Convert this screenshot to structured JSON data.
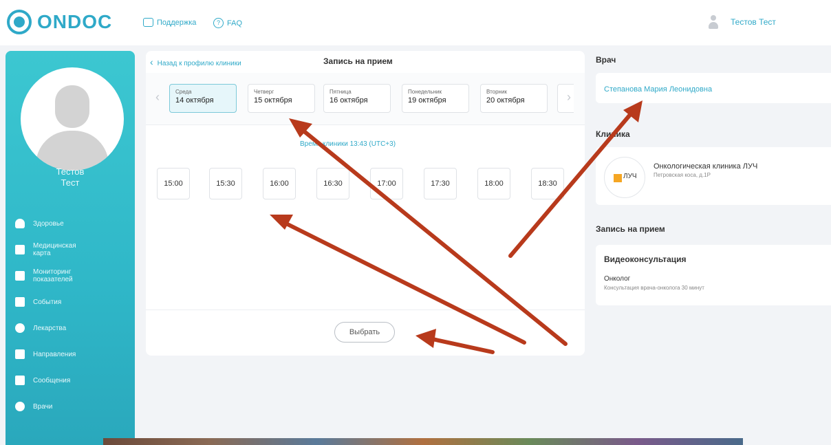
{
  "header": {
    "logo_text": "ONDOC",
    "support_label": "Поддержка",
    "faq_label": "FAQ",
    "user_name": "Тестов Тест"
  },
  "sidebar": {
    "first_name": "Тестов",
    "last_name": "Тест",
    "items": [
      {
        "label": "Здоровье",
        "icon": "heart-icon"
      },
      {
        "label": "Медицинская карта",
        "icon": "medical-card-icon"
      },
      {
        "label": "Мониторинг показателей",
        "icon": "chart-icon"
      },
      {
        "label": "События",
        "icon": "calendar-icon"
      },
      {
        "label": "Лекарства",
        "icon": "pills-icon"
      },
      {
        "label": "Направления",
        "icon": "referral-icon"
      },
      {
        "label": "Сообщения",
        "icon": "messages-icon"
      },
      {
        "label": "Врачи",
        "icon": "doctor-icon"
      }
    ]
  },
  "main": {
    "back_label": "Назад к профилю клиники",
    "title": "Запись на прием",
    "dates": [
      {
        "dow": "Среда",
        "dm": "14 октября",
        "active": true
      },
      {
        "dow": "Четверг",
        "dm": "15 октября",
        "active": false
      },
      {
        "dow": "Пятница",
        "dm": "16 октября",
        "active": false
      },
      {
        "dow": "Понедельник",
        "dm": "19 октября",
        "active": false
      },
      {
        "dow": "Вторник",
        "dm": "20 октября",
        "active": false
      }
    ],
    "timezone_label": "Время клиники 13:43 (UTC+3)",
    "slots": [
      "15:00",
      "15:30",
      "16:00",
      "16:30",
      "17:00",
      "17:30",
      "18:00",
      "18:30"
    ],
    "select_button": "Выбрать"
  },
  "right": {
    "doctor_title": "Врач",
    "doctor_name": "Степанова Мария Леонидовна",
    "clinic_title": "Клиника",
    "clinic_logo_text": "ЛУЧ",
    "clinic_name": "Онкологическая клиника ЛУЧ",
    "clinic_address": "Петровская коса, д.1Р",
    "appointment_title": "Запись на прием",
    "consult_type": "Видеоконсультация",
    "consult_specialty": "Онколог",
    "consult_description": "Консультация врача-онколога 30 минут"
  },
  "colors": {
    "accent": "#2fa9c8",
    "sidebar": "#35bccb",
    "arrow": "#b83a1c"
  }
}
